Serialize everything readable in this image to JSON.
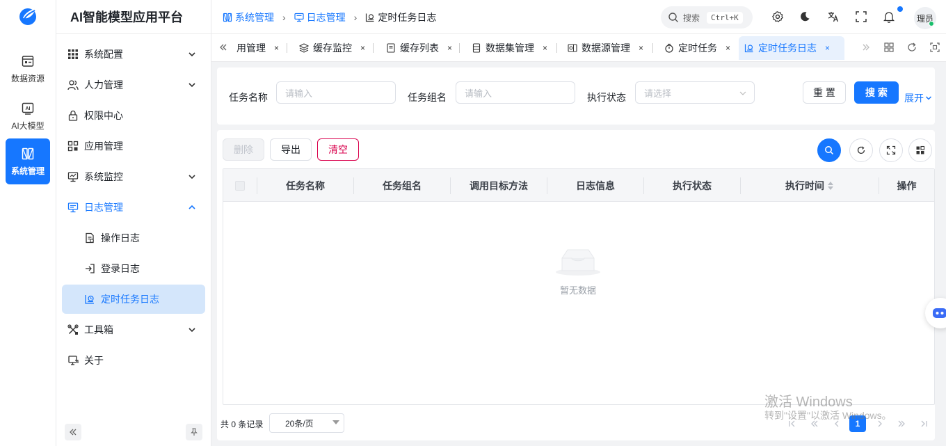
{
  "app": {
    "title": "AI智能模型应用平台",
    "accent": "#1677ff"
  },
  "rail": {
    "items": [
      {
        "label": "数据资源",
        "icon": "database-icon"
      },
      {
        "label": "AI大模型",
        "icon": "ai-chip-icon"
      },
      {
        "label": "系统管理",
        "icon": "system-icon",
        "active": true
      }
    ]
  },
  "menu": {
    "items": [
      {
        "label": "系统配置",
        "icon": "grid-icon"
      },
      {
        "label": "人力管理",
        "icon": "users-icon"
      },
      {
        "label": "权限中心",
        "icon": "lock-icon"
      },
      {
        "label": "应用管理",
        "icon": "apps-icon"
      },
      {
        "label": "系统监控",
        "icon": "monitor-icon"
      },
      {
        "label": "日志管理",
        "icon": "log-icon"
      },
      {
        "label": "操作日志",
        "icon": "file-log-icon"
      },
      {
        "label": "登录日志",
        "icon": "login-icon"
      },
      {
        "label": "定时任务日志",
        "icon": "schedule-log-icon"
      },
      {
        "label": "工具箱",
        "icon": "tools-icon"
      },
      {
        "label": "关于",
        "icon": "about-icon"
      }
    ]
  },
  "breadcrumb": {
    "items": [
      "系统管理",
      "日志管理",
      "定时任务日志"
    ]
  },
  "header": {
    "search_label": "搜索",
    "search_shortcut": "Ctrl+K",
    "avatar_text": "理员"
  },
  "tabs": {
    "items": [
      {
        "label": "用管理"
      },
      {
        "label": "缓存监控"
      },
      {
        "label": "缓存列表"
      },
      {
        "label": "数据集管理"
      },
      {
        "label": "数据源管理"
      },
      {
        "label": "定时任务"
      },
      {
        "label": "定时任务日志",
        "active": true
      }
    ],
    "close_glyph": "×"
  },
  "filter": {
    "task_name_label": "任务名称",
    "task_name_placeholder": "请输入",
    "task_group_label": "任务组名",
    "task_group_placeholder": "请输入",
    "status_label": "执行状态",
    "status_placeholder": "请选择",
    "reset_label": "重 置",
    "search_label": "搜 索",
    "expand_label": "展开"
  },
  "toolbar": {
    "delete_label": "删除",
    "export_label": "导出",
    "clear_label": "清空"
  },
  "table": {
    "columns": [
      "任务名称",
      "任务组名",
      "调用目标方法",
      "日志信息",
      "执行状态",
      "执行时间",
      "操作"
    ],
    "rows": [],
    "empty_text": "暂无数据"
  },
  "pagination": {
    "total_text": "共 0 条记录",
    "page_size": "20条/页",
    "current_page": "1"
  },
  "watermark": {
    "line1": "激活 Windows",
    "line2": "转到\"设置\"以激活 Windows。"
  }
}
